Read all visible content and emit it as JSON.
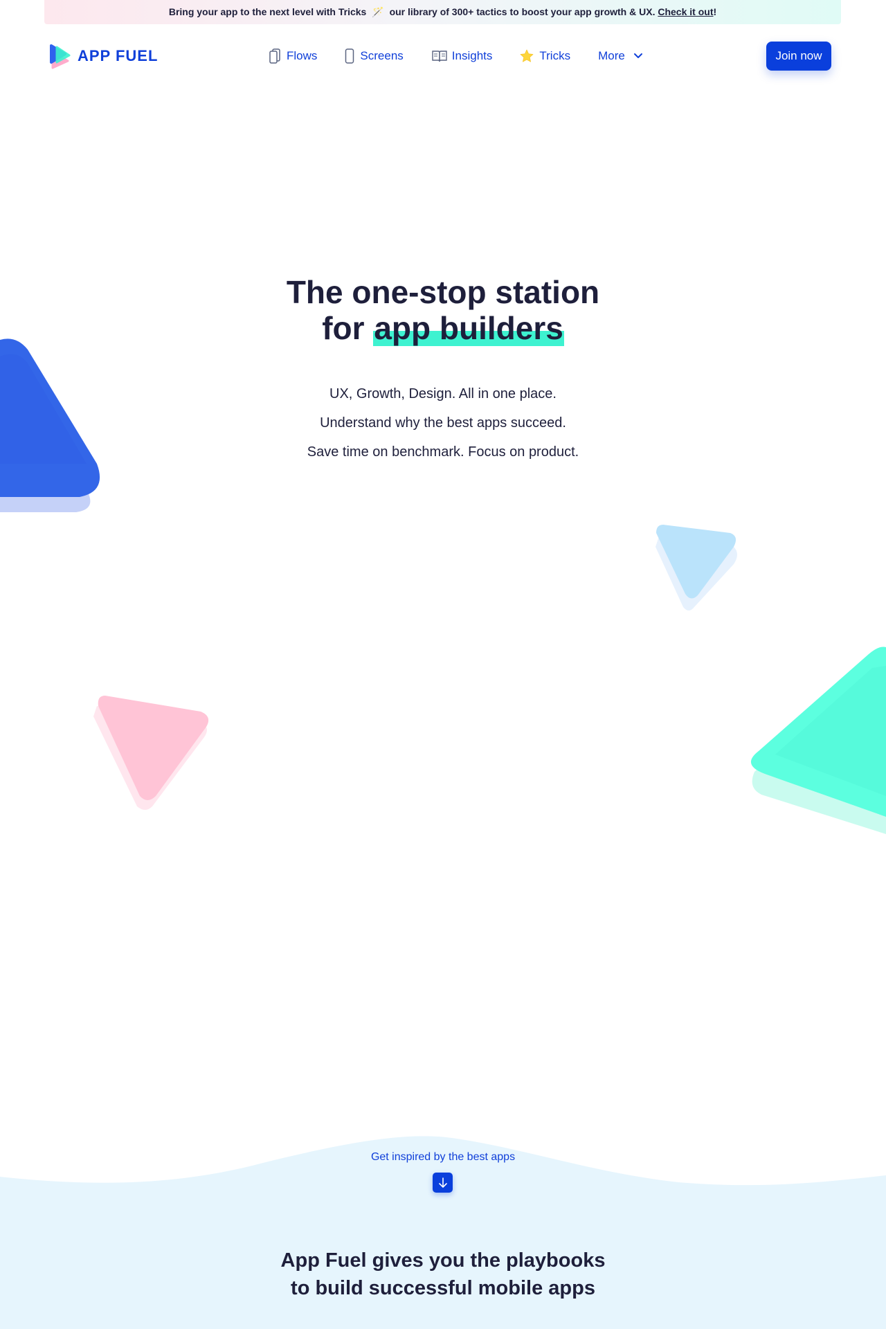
{
  "banner": {
    "text_before": "Bring your app to the next level with Tricks",
    "wand": "🪄",
    "text_after": "our library of 300+ tactics to boost your app growth & UX.",
    "link": "Check it out",
    "end": "!"
  },
  "logo": {
    "text": "APP FUEL"
  },
  "nav": {
    "items": [
      {
        "label": "Flows",
        "icon": "flows-icon"
      },
      {
        "label": "Screens",
        "icon": "phone-icon"
      },
      {
        "label": "Insights",
        "icon": "book-icon"
      },
      {
        "label": "Tricks",
        "icon": "star-icon"
      },
      {
        "label": "More",
        "icon": "chevron-down-icon"
      }
    ]
  },
  "join_button": "Join now",
  "hero": {
    "title_line1": "The one-stop station",
    "title_line2_prefix": "for",
    "title_highlight": "app builders",
    "sub1": "UX, Growth, Design. All in one place.",
    "sub2": "Understand why the best apps succeed.",
    "sub3": "Save time on benchmark. Focus on product."
  },
  "inspire": {
    "text": "Get inspired by the best apps",
    "icon": "arrow-down-icon"
  },
  "section2": {
    "line1": "App Fuel gives you the playbooks",
    "line2": "to build successful mobile apps"
  },
  "colors": {
    "primary": "#0a3fdc",
    "heading": "#1e1f3b",
    "highlight": "#3ef2d0",
    "triangle_blue": "#3366e8",
    "triangle_light_blue": "#bae3fb",
    "triangle_pink": "#ffc4d6",
    "triangle_mint": "#5cffdf",
    "section_bg": "#e6f5fd"
  }
}
